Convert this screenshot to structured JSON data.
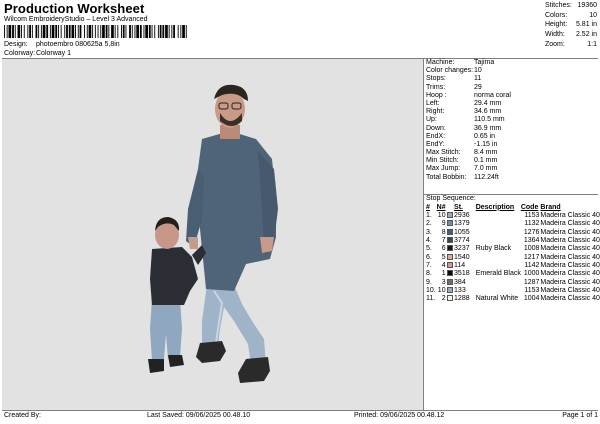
{
  "header": {
    "title": "Production Worksheet",
    "subtitle": "Wilcom EmbroideryStudio – Level 3 Advanced",
    "design_label": "Design:",
    "design_value": "photoembro 080625a 5,8in",
    "colorway_label": "Colorway:",
    "colorway_value": "Colorway 1"
  },
  "stats": [
    {
      "label": "Stitches:",
      "value": "19360"
    },
    {
      "label": "Colors:",
      "value": "10"
    },
    {
      "label": "Height:",
      "value": "5.81 in"
    },
    {
      "label": "Width:",
      "value": "2.52 in"
    },
    {
      "label": "Zoom:",
      "value": "1:1"
    }
  ],
  "info": [
    {
      "label": "Machine:",
      "value": "Tajima"
    },
    {
      "label": "Color changes:",
      "value": "10"
    },
    {
      "label": "Stops:",
      "value": "11"
    },
    {
      "label": "Trims:",
      "value": "29"
    },
    {
      "label": "Hoop :",
      "value": "norma coral"
    },
    {
      "label": "Left:",
      "value": "29.4 mm"
    },
    {
      "label": "Right:",
      "value": "34.6 mm"
    },
    {
      "label": "Up:",
      "value": "110.5 mm"
    },
    {
      "label": "Down:",
      "value": "36.9 mm"
    },
    {
      "label": "EndX:",
      "value": "0.65 in"
    },
    {
      "label": "EndY:",
      "value": "-1.15 in"
    },
    {
      "label": "Max Stitch:",
      "value": "8.4 mm"
    },
    {
      "label": "Min Stitch:",
      "value": "0.1 mm"
    },
    {
      "label": "Max Jump:",
      "value": "7.0 mm"
    },
    {
      "label": "Total Bobbin:",
      "value": "112.24ft"
    }
  ],
  "stop_sequence": {
    "title": "Stop Sequence:",
    "headers": {
      "num": "#",
      "n": "N#",
      "st": "St.",
      "desc": "Description",
      "code": "Code",
      "brand": "Brand"
    },
    "rows": [
      {
        "num": "1.",
        "n": "10",
        "color": "#9aa9bb",
        "st": "2936",
        "desc": "",
        "code": "1153",
        "brand": "Madeira Classic 40"
      },
      {
        "num": "2.",
        "n": "9",
        "color": "#6d8fae",
        "st": "1379",
        "desc": "",
        "code": "1132",
        "brand": "Madeira Classic 40"
      },
      {
        "num": "3.",
        "n": "8",
        "color": "#3f5f86",
        "st": "1055",
        "desc": "",
        "code": "1276",
        "brand": "Madeira Classic 40"
      },
      {
        "num": "4.",
        "n": "7",
        "color": "#3a4650",
        "st": "3774",
        "desc": "",
        "code": "1364",
        "brand": "Madeira Classic 40"
      },
      {
        "num": "5.",
        "n": "6",
        "color": "#151515",
        "st": "3237",
        "desc": "Ruby Black",
        "code": "1008",
        "brand": "Madeira Classic 40"
      },
      {
        "num": "6.",
        "n": "5",
        "color": "#e6a89a",
        "st": "1540",
        "desc": "",
        "code": "1217",
        "brand": "Madeira Classic 40"
      },
      {
        "num": "7.",
        "n": "4",
        "color": "#c99a94",
        "st": "114",
        "desc": "",
        "code": "1142",
        "brand": "Madeira Classic 40"
      },
      {
        "num": "8.",
        "n": "1",
        "color": "#0a0a0a",
        "st": "3518",
        "desc": "Emerald Black",
        "code": "1000",
        "brand": "Madeira Classic 40"
      },
      {
        "num": "9.",
        "n": "3",
        "color": "#6e6e6e",
        "st": "384",
        "desc": "",
        "code": "1287",
        "brand": "Madeira Classic 40"
      },
      {
        "num": "10.",
        "n": "10",
        "color": "#9aa9bb",
        "st": "133",
        "desc": "",
        "code": "1153",
        "brand": "Madeira Classic 40"
      },
      {
        "num": "11.",
        "n": "2",
        "color": "#f4f4f0",
        "st": "1288",
        "desc": "Natural White",
        "code": "1004",
        "brand": "Madeira Classic 40"
      }
    ]
  },
  "footer": {
    "created_by": "Created By:",
    "last_saved": "Last Saved: 09/06/2025 00.48.10",
    "printed": "Printed: 09/06/2025 00.48.12",
    "page": "Page 1 of 1"
  }
}
